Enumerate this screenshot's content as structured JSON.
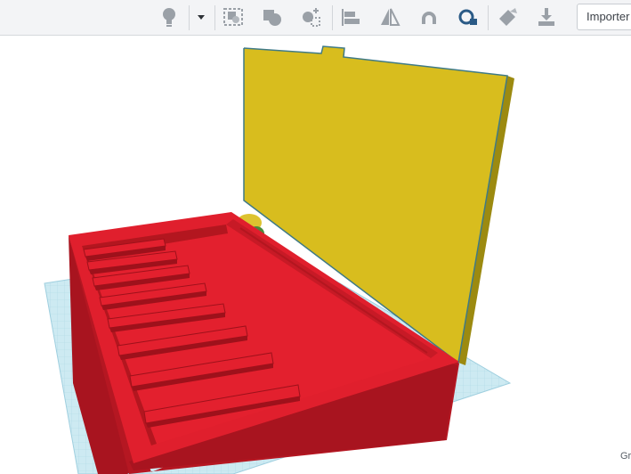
{
  "toolbar": {
    "import_label": "Importer",
    "icons": [
      "lightbulb-icon",
      "chevron-down-icon",
      "group-icon",
      "ungroup-icon",
      "hole-icon",
      "align-icon",
      "mirror-icon",
      "cruise-magnet-icon",
      "ruler-icon",
      "workplane-icon",
      "import-export-icon"
    ]
  },
  "workspace": {
    "grid_label": "Gr"
  },
  "colors": {
    "box_red": "#d11b2c",
    "lid_yellow": "#dcc01c",
    "grid_blue": "#cdeaf2",
    "toolbar_bg": "#f3f4f6"
  }
}
